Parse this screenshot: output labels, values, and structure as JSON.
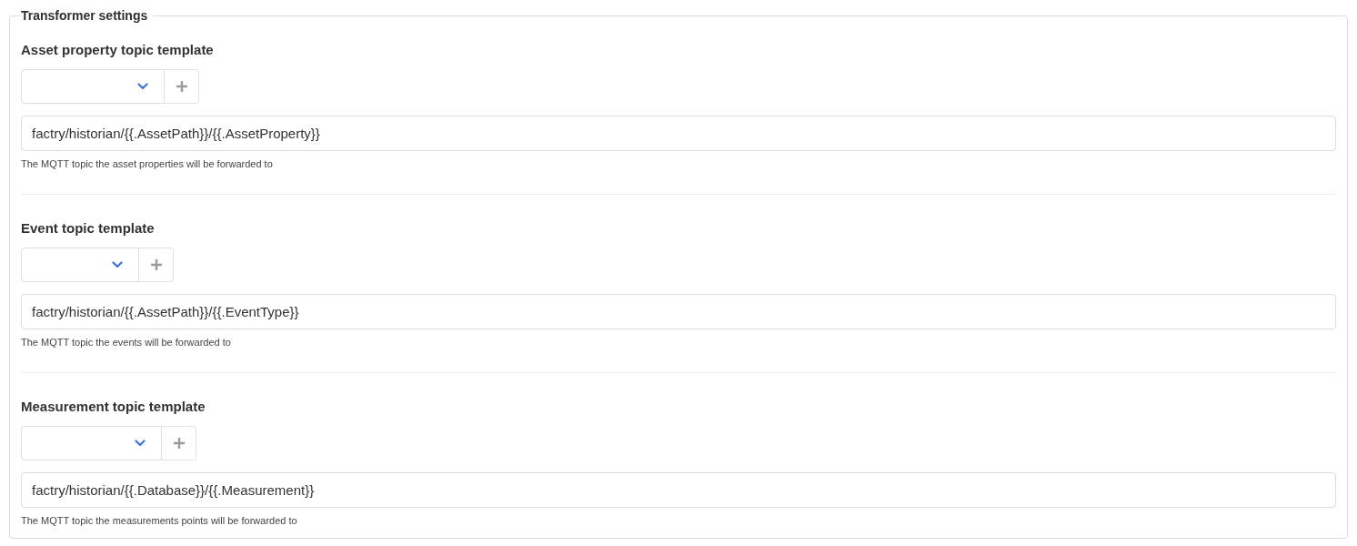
{
  "fieldset": {
    "legend": "Transformer settings"
  },
  "fields": [
    {
      "label": "Asset property topic template",
      "value": "factry/historian/{{.AssetPath}}/{{.AssetProperty}}",
      "help": "The MQTT topic the asset properties will be forwarded to"
    },
    {
      "label": "Event topic template",
      "value": "factry/historian/{{.AssetPath}}/{{.EventType}}",
      "help": "The MQTT topic the events will be forwarded to"
    },
    {
      "label": "Measurement topic template",
      "value": "factry/historian/{{.Database}}/{{.Measurement}}",
      "help": "The MQTT topic the measurements points will be forwarded to"
    }
  ]
}
